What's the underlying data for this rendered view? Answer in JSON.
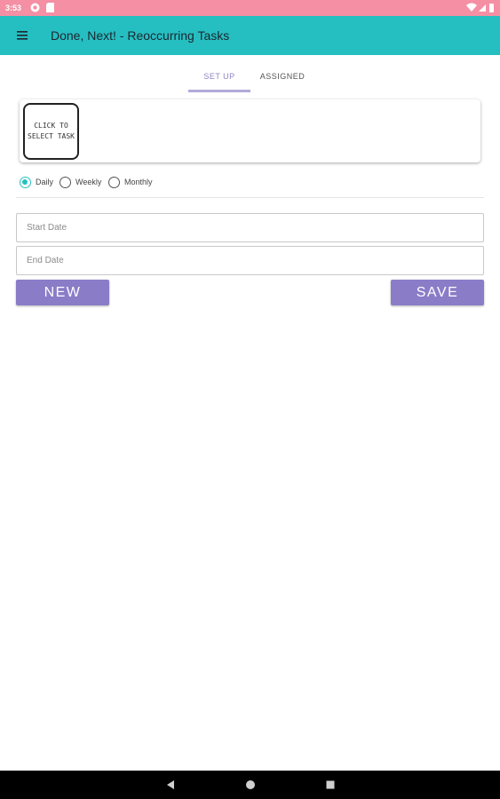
{
  "status_bar": {
    "time": "3:53",
    "icons": [
      "notification-icon",
      "sd-card-icon",
      "wifi-icon",
      "signal-icon",
      "battery-icon"
    ]
  },
  "app_bar": {
    "title": "Done, Next! - Reoccurring Tasks",
    "menu_icon": "hamburger-menu-icon",
    "color": "#26bfc1"
  },
  "tabs": {
    "items": [
      {
        "label": "SET UP",
        "selected": true
      },
      {
        "label": "ASSIGNED",
        "selected": false
      }
    ],
    "accent_color": "#8e84c6"
  },
  "task_selector": {
    "label": "Click to select task"
  },
  "frequency": {
    "options": [
      {
        "label": "Daily",
        "selected": true
      },
      {
        "label": "Weekly",
        "selected": false
      },
      {
        "label": "Monthly",
        "selected": false
      }
    ],
    "accent_color": "#26bfc1"
  },
  "form": {
    "start_date": {
      "value": "",
      "placeholder": "Start Date"
    },
    "end_date": {
      "value": "",
      "placeholder": "End Date"
    }
  },
  "buttons": {
    "new_label": "NEW",
    "save_label": "SAVE",
    "color": "#8b7cc8"
  },
  "nav_bar": {
    "icons": [
      "back-icon",
      "home-icon",
      "recents-icon"
    ]
  }
}
